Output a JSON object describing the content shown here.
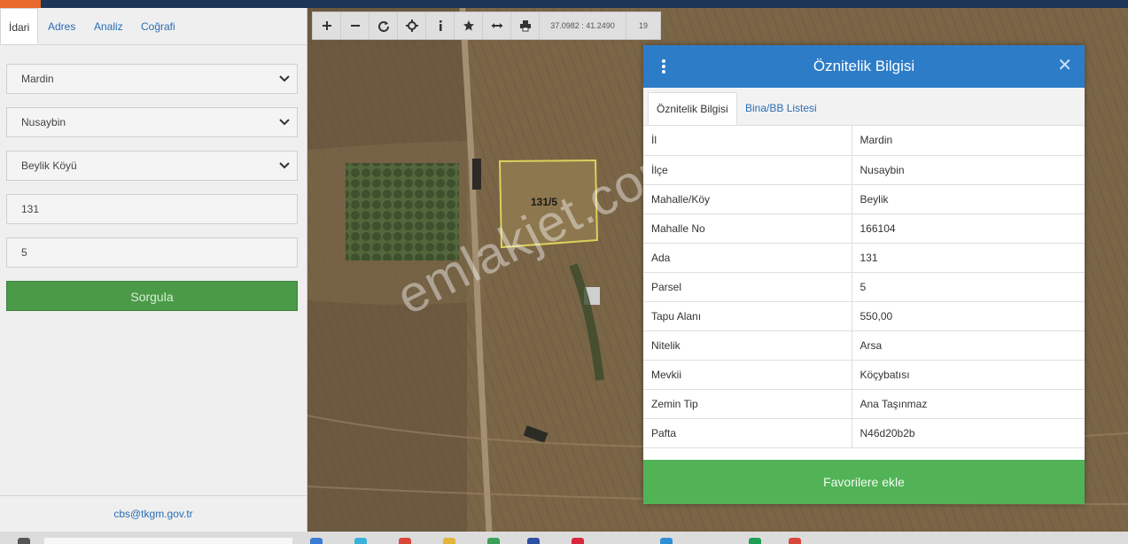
{
  "sidebar": {
    "tabs": [
      "İdari",
      "Adres",
      "Analiz",
      "Coğrafi"
    ],
    "il": "Mardin",
    "ilce": "Nusaybin",
    "mahalle": "Beylik Köyü",
    "ada": "131",
    "parsel": "5",
    "query_button": "Sorgula",
    "footer_email": "cbs@tkgm.gov.tr"
  },
  "map": {
    "toolbar": {
      "icons": [
        "plus-icon",
        "minus-icon",
        "refresh-icon",
        "crosshair-icon",
        "info-icon",
        "star-icon",
        "measure-icon",
        "print-icon"
      ],
      "coords": "37.0982 : 41.2490",
      "zoom": "19"
    },
    "parcel_label": "131/5",
    "watermark": "emlakjet.com"
  },
  "popup": {
    "title": "Öznitelik Bilgisi",
    "tabs": [
      "Öznitelik Bilgisi",
      "Bina/BB Listesi"
    ],
    "rows": [
      {
        "key": "İl",
        "value": "Mardin"
      },
      {
        "key": "İlçe",
        "value": "Nusaybin"
      },
      {
        "key": "Mahalle/Köy",
        "value": "Beylik"
      },
      {
        "key": "Mahalle No",
        "value": "166104"
      },
      {
        "key": "Ada",
        "value": "131"
      },
      {
        "key": "Parsel",
        "value": "5"
      },
      {
        "key": "Tapu Alanı",
        "value": "550,00"
      },
      {
        "key": "Nitelik",
        "value": "Arsa"
      },
      {
        "key": "Mevkii",
        "value": "Köçybatısı"
      },
      {
        "key": "Zemin Tip",
        "value": "Ana Taşınmaz"
      },
      {
        "key": "Pafta",
        "value": "N46d20b2b"
      }
    ],
    "favorite_button": "Favorilere ekle"
  },
  "colors": {
    "header_blue": "#2d7cc8",
    "query_green": "#4a9a47",
    "favorite_green": "#51b356",
    "top_accent": "#e8692a",
    "link_blue": "#2a6db4"
  }
}
